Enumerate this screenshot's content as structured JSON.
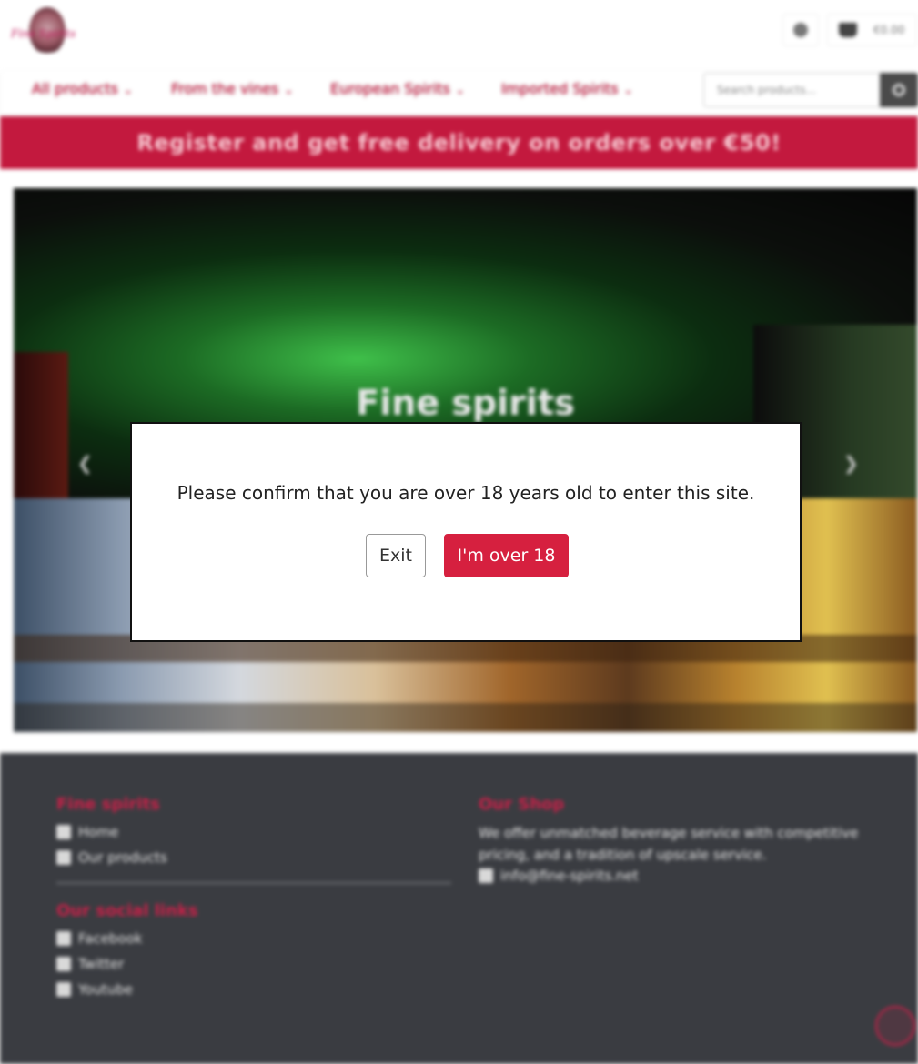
{
  "header": {
    "logo_text": "Fine Spirits",
    "cart_amount": "€0.00"
  },
  "nav": {
    "items": [
      {
        "label": "All products"
      },
      {
        "label": "From the vines"
      },
      {
        "label": "European Spirits"
      },
      {
        "label": "Imported Spirits"
      }
    ],
    "search_placeholder": "Search products..."
  },
  "promo": {
    "text": "Register and get free delivery on orders over €50!"
  },
  "hero": {
    "title": "Fine spirits"
  },
  "footer": {
    "col1": {
      "heading": "Fine spirits",
      "links": [
        {
          "label": "Home",
          "icon": "map-pin-icon"
        },
        {
          "label": "Our products",
          "icon": "link-icon"
        }
      ],
      "social_heading": "Our social links",
      "social_links": [
        {
          "label": "Facebook",
          "icon": "facebook-icon"
        },
        {
          "label": "Twitter",
          "icon": "twitter-icon"
        },
        {
          "label": "Youtube",
          "icon": "youtube-icon"
        }
      ]
    },
    "col2": {
      "heading": "Our Shop",
      "description": "We offer unmatched beverage service with competitive pricing, and a tradition of upscale service.",
      "email": "info@fine-spirits.net"
    }
  },
  "age_gate": {
    "message": "Please confirm that you are over 18 years old to enter this site.",
    "exit_label": "Exit",
    "confirm_label": "I'm over 18"
  },
  "colors": {
    "brand": "#d6203f",
    "footer_bg": "#3a3c41"
  }
}
